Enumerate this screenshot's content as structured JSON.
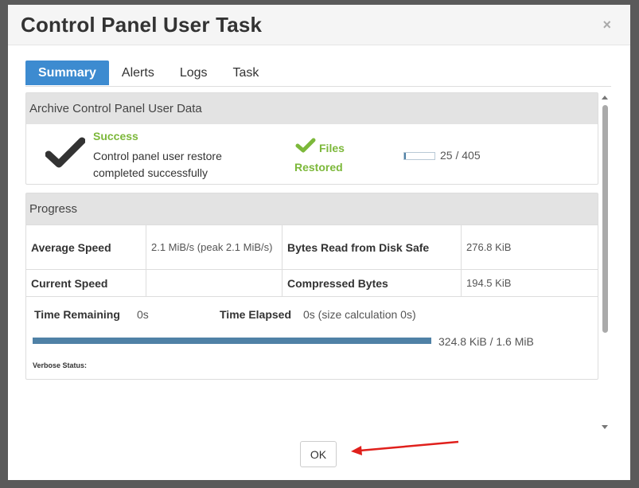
{
  "dialog": {
    "title": "Control Panel User Task",
    "close_glyph": "×"
  },
  "tabs": [
    {
      "label": "Summary",
      "active": true
    },
    {
      "label": "Alerts",
      "active": false
    },
    {
      "label": "Logs",
      "active": false
    },
    {
      "label": "Task",
      "active": false
    }
  ],
  "archive_panel": {
    "heading": "Archive Control Panel User Data",
    "status_title": "Success",
    "status_message": "Control panel user restore completed successfully",
    "files_label_1": "Files",
    "files_label_2": "Restored",
    "files_count": "25 / 405",
    "files_fraction": 0.062
  },
  "progress_panel": {
    "heading": "Progress",
    "average_speed_label": "Average Speed",
    "average_speed_value": "2.1 MiB/s (peak 2.1 MiB/s)",
    "bytes_read_label": "Bytes Read from Disk Safe",
    "bytes_read_value": "276.8 KiB",
    "current_speed_label": "Current Speed",
    "current_speed_value": "",
    "compressed_label": "Compressed Bytes",
    "compressed_value": "194.5 KiB",
    "time_remaining_label": "Time Remaining",
    "time_remaining_value": "0s",
    "time_elapsed_label": "Time Elapsed",
    "time_elapsed_value": "0s (size calculation 0s)",
    "progress_text": "324.8 KiB / 1.6 MiB",
    "progress_fraction": 1.0,
    "verbose_label": "Verbose Status:"
  },
  "footer": {
    "ok_label": "OK"
  },
  "colors": {
    "accent": "#3d8bd0",
    "success": "#7cb83a",
    "progress": "#4f81a6",
    "annotation_arrow": "#e0201c"
  },
  "icons": {
    "status": "checkmark-icon",
    "files": "checkmark-icon",
    "close": "close-icon"
  }
}
